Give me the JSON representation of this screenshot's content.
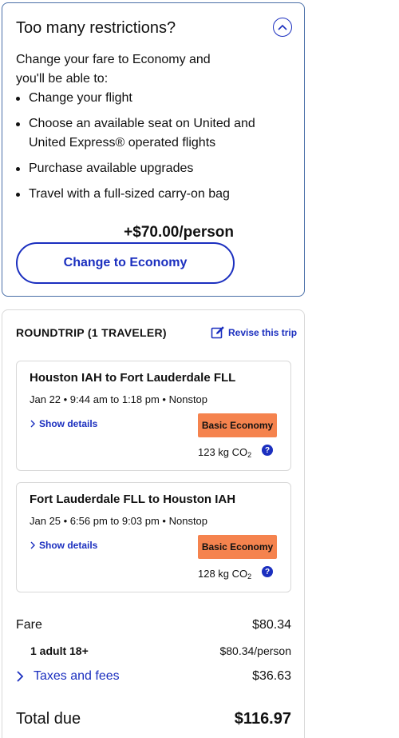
{
  "restrictions": {
    "title": "Too many restrictions?",
    "intro": "Change your fare to Economy and you'll be able to:",
    "items": [
      "Change your flight",
      "Choose an available seat on United and United Express® operated flights",
      "Purchase available upgrades",
      "Travel with a full-sized carry-on bag"
    ],
    "price": "+$70.00/person",
    "button_label": "Change to Economy"
  },
  "trip": {
    "heading": "ROUNDTRIP (1 TRAVELER)",
    "revise_label": "Revise this trip",
    "flights": [
      {
        "route": "Houston IAH to Fort Lauderdale FLL",
        "time": "Jan 22 • 9:44 am to 1:18 pm • Nonstop",
        "details_label": "Show details",
        "fare_class": "Basic Economy",
        "co2_value": "123 kg CO",
        "co2_sub": "2"
      },
      {
        "route": "Fort Lauderdale FLL to Houston IAH",
        "time": "Jan 25 • 6:56 pm to 9:03 pm • Nonstop",
        "details_label": "Show details",
        "fare_class": "Basic Economy",
        "co2_value": "128 kg CO",
        "co2_sub": "2"
      }
    ],
    "fare_label": "Fare",
    "fare_value": "$80.34",
    "adult_label": "1 adult 18+",
    "adult_value": "$80.34/person",
    "taxes_label": "Taxes and fees",
    "taxes_value": "$36.63",
    "total_label": "Total due",
    "total_value": "$116.97"
  },
  "colors": {
    "brand_blue": "#1b2fbf",
    "badge_orange": "#f5834e"
  },
  "icons": {
    "collapse": "chevron-up-icon",
    "revise": "edit-icon",
    "details": "chevron-right-icon",
    "help": "question-icon"
  }
}
